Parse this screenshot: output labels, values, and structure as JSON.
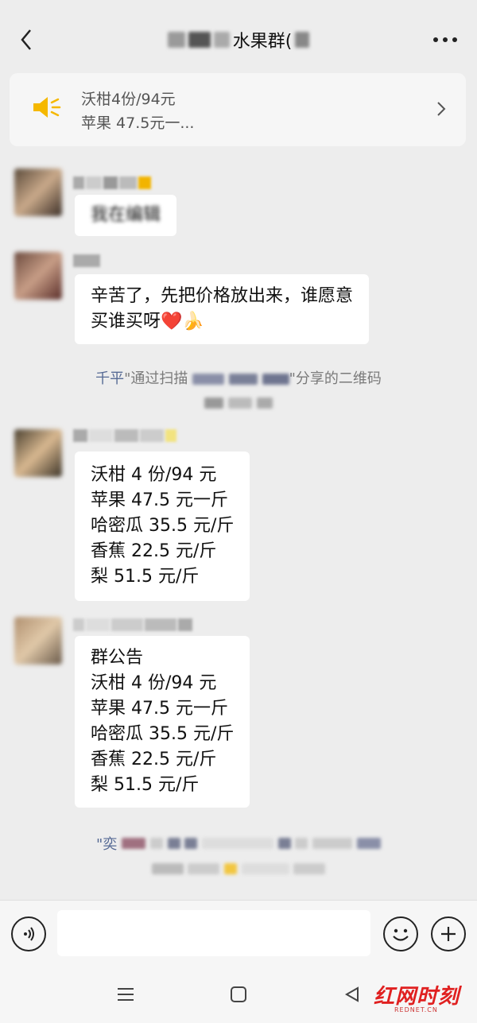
{
  "header": {
    "title_visible": "水果群(",
    "back_icon": "chevron-left-icon",
    "more_icon": "more-horizontal-icon"
  },
  "notice": {
    "icon": "speaker-icon",
    "line1": "沃柑4份/94元",
    "line2": "苹果 47.5元一...",
    "chevron_icon": "chevron-right-icon",
    "icon_color": "#f5b800"
  },
  "messages": [
    {
      "text_lines": [
        "我在编辑"
      ]
    },
    {
      "text_lines": [
        "辛苦了，先把价格放出来，谁愿意",
        "买谁买呀"
      ],
      "emoji": "❤️🍌"
    },
    {
      "text_lines": [
        "沃柑 4 份/94 元",
        "苹果 47.5 元一斤",
        "哈密瓜 35.5 元/斤",
        "香蕉 22.5 元/斤",
        "梨 51.5 元/斤"
      ]
    },
    {
      "text_lines": [
        "群公告",
        "沃柑 4 份/94 元",
        "苹果 47.5 元一斤",
        "哈密瓜 35.5 元/斤",
        "香蕉 22.5 元/斤",
        "梨 51.5 元/斤"
      ]
    }
  ],
  "system_notices": [
    {
      "highlight": "千平",
      "mid": "\"通过扫描",
      "tail": "\"分享的二维码"
    },
    {
      "highlight": "\"奕",
      "mid": "",
      "tail": ""
    }
  ],
  "input_bar": {
    "voice_icon": "voice-icon",
    "emoji_icon": "emoji-icon",
    "plus_icon": "plus-icon"
  },
  "watermark": {
    "main": "红网时刻",
    "sub": "REDNET.CN"
  },
  "colors": {
    "background": "#ededed",
    "bubble": "#ffffff",
    "link": "#576b95",
    "watermark": "#e02020"
  }
}
